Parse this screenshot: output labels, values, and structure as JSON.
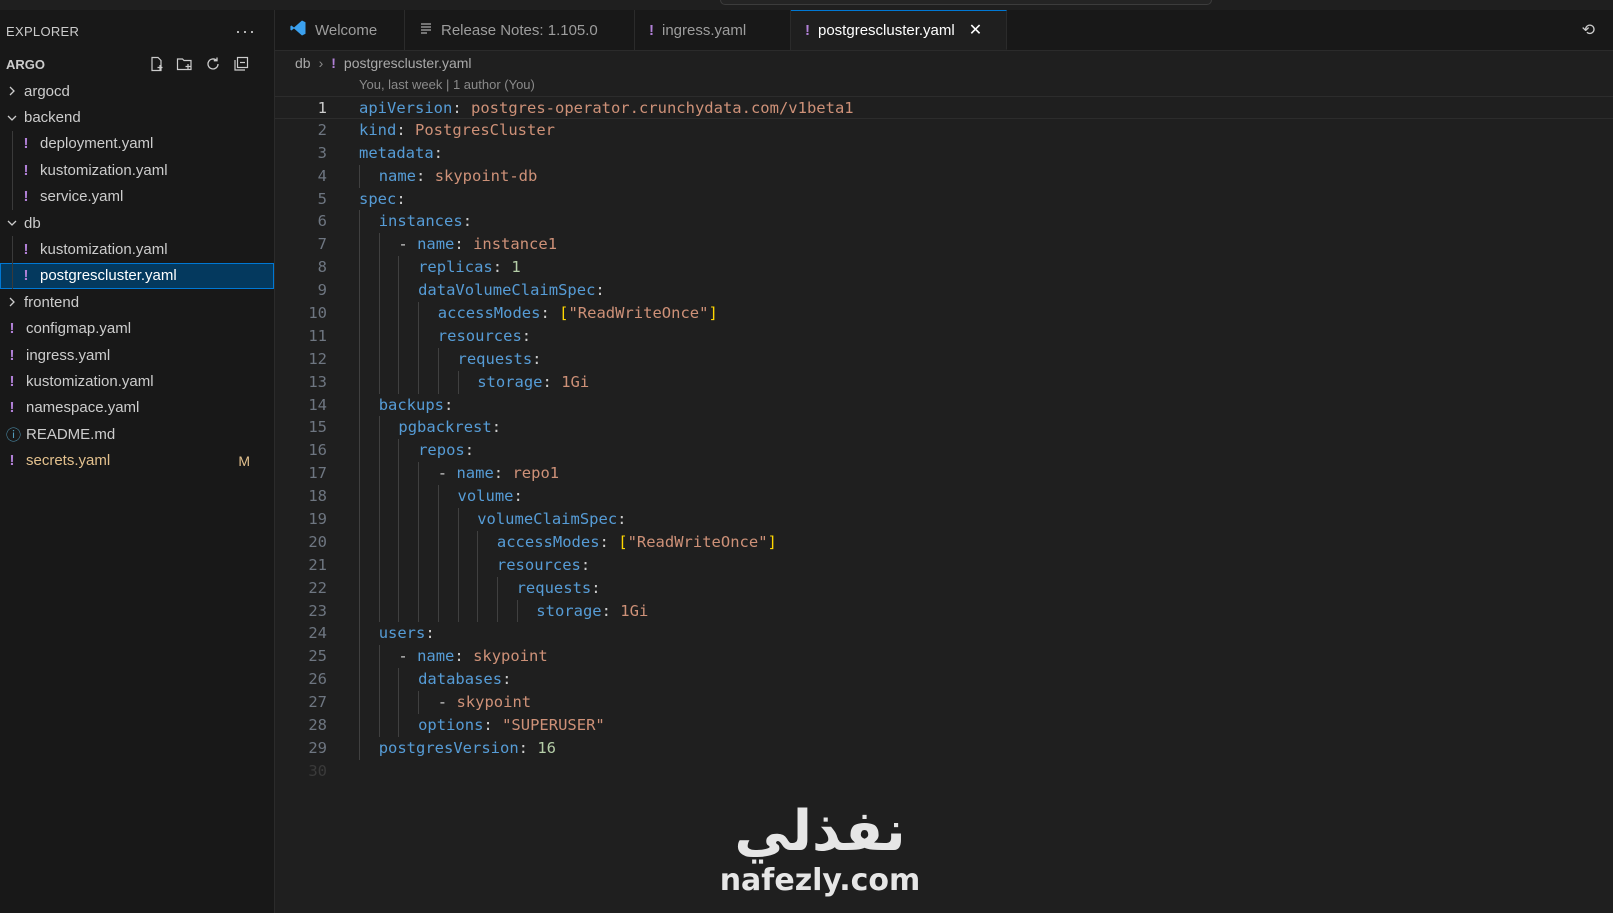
{
  "sidebar": {
    "title": "EXPLORER",
    "more": "···",
    "project": "ARGO",
    "tree": [
      {
        "label": "argocd",
        "type": "folder",
        "open": false,
        "depth": 0
      },
      {
        "label": "backend",
        "type": "folder",
        "open": true,
        "depth": 0
      },
      {
        "label": "deployment.yaml",
        "type": "yaml",
        "depth": 1
      },
      {
        "label": "kustomization.yaml",
        "type": "yaml",
        "depth": 1
      },
      {
        "label": "service.yaml",
        "type": "yaml",
        "depth": 1
      },
      {
        "label": "db",
        "type": "folder",
        "open": true,
        "depth": 0
      },
      {
        "label": "kustomization.yaml",
        "type": "yaml",
        "depth": 1
      },
      {
        "label": "postgrescluster.yaml",
        "type": "yaml",
        "depth": 1,
        "selected": true
      },
      {
        "label": "frontend",
        "type": "folder",
        "open": false,
        "depth": 0
      },
      {
        "label": "configmap.yaml",
        "type": "yaml",
        "depth": 0
      },
      {
        "label": "ingress.yaml",
        "type": "yaml",
        "depth": 0
      },
      {
        "label": "kustomization.yaml",
        "type": "yaml",
        "depth": 0
      },
      {
        "label": "namespace.yaml",
        "type": "yaml",
        "depth": 0
      },
      {
        "label": "README.md",
        "type": "md",
        "depth": 0
      },
      {
        "label": "secrets.yaml",
        "type": "yaml",
        "depth": 0,
        "badge": "M"
      }
    ]
  },
  "tabs": [
    {
      "label": "Welcome",
      "icon": "vscode-icon"
    },
    {
      "label": "Release Notes: 1.105.0",
      "icon": "notes-icon"
    },
    {
      "label": "ingress.yaml",
      "icon": "yaml-icon"
    },
    {
      "label": "postgrescluster.yaml",
      "icon": "yaml-icon",
      "active": true
    }
  ],
  "breadcrumb": {
    "folder": "db",
    "file": "postgrescluster.yaml"
  },
  "blame": "You, last week | 1 author (You)",
  "code": [
    [
      0,
      [
        [
          "k",
          "apiVersion"
        ],
        [
          "p",
          ": "
        ],
        [
          "s",
          "postgres-operator.crunchydata.com/v1beta1"
        ]
      ]
    ],
    [
      0,
      [
        [
          "k",
          "kind"
        ],
        [
          "p",
          ": "
        ],
        [
          "s",
          "PostgresCluster"
        ]
      ]
    ],
    [
      0,
      [
        [
          "k",
          "metadata"
        ],
        [
          "p",
          ":"
        ]
      ]
    ],
    [
      1,
      [
        [
          "k",
          "name"
        ],
        [
          "p",
          ": "
        ],
        [
          "s",
          "skypoint-db"
        ]
      ]
    ],
    [
      0,
      [
        [
          "k",
          "spec"
        ],
        [
          "p",
          ":"
        ]
      ]
    ],
    [
      1,
      [
        [
          "k",
          "instances"
        ],
        [
          "p",
          ":"
        ]
      ]
    ],
    [
      2,
      [
        [
          "p",
          "- "
        ],
        [
          "k",
          "name"
        ],
        [
          "p",
          ": "
        ],
        [
          "s",
          "instance1"
        ]
      ]
    ],
    [
      3,
      [
        [
          "k",
          "replicas"
        ],
        [
          "p",
          ": "
        ],
        [
          "n",
          "1"
        ]
      ]
    ],
    [
      3,
      [
        [
          "k",
          "dataVolumeClaimSpec"
        ],
        [
          "p",
          ":"
        ]
      ]
    ],
    [
      4,
      [
        [
          "k",
          "accessModes"
        ],
        [
          "p",
          ": "
        ],
        [
          "br",
          "["
        ],
        [
          "s",
          "\"ReadWriteOnce\""
        ],
        [
          "br",
          "]"
        ]
      ]
    ],
    [
      4,
      [
        [
          "k",
          "resources"
        ],
        [
          "p",
          ":"
        ]
      ]
    ],
    [
      5,
      [
        [
          "k",
          "requests"
        ],
        [
          "p",
          ":"
        ]
      ]
    ],
    [
      6,
      [
        [
          "k",
          "storage"
        ],
        [
          "p",
          ": "
        ],
        [
          "s",
          "1Gi"
        ]
      ]
    ],
    [
      1,
      [
        [
          "k",
          "backups"
        ],
        [
          "p",
          ":"
        ]
      ]
    ],
    [
      2,
      [
        [
          "k",
          "pgbackrest"
        ],
        [
          "p",
          ":"
        ]
      ]
    ],
    [
      3,
      [
        [
          "k",
          "repos"
        ],
        [
          "p",
          ":"
        ]
      ]
    ],
    [
      4,
      [
        [
          "p",
          "- "
        ],
        [
          "k",
          "name"
        ],
        [
          "p",
          ": "
        ],
        [
          "s",
          "repo1"
        ]
      ]
    ],
    [
      5,
      [
        [
          "k",
          "volume"
        ],
        [
          "p",
          ":"
        ]
      ]
    ],
    [
      6,
      [
        [
          "k",
          "volumeClaimSpec"
        ],
        [
          "p",
          ":"
        ]
      ]
    ],
    [
      7,
      [
        [
          "k",
          "accessModes"
        ],
        [
          "p",
          ": "
        ],
        [
          "br",
          "["
        ],
        [
          "s",
          "\"ReadWriteOnce\""
        ],
        [
          "br",
          "]"
        ]
      ]
    ],
    [
      7,
      [
        [
          "k",
          "resources"
        ],
        [
          "p",
          ":"
        ]
      ]
    ],
    [
      8,
      [
        [
          "k",
          "requests"
        ],
        [
          "p",
          ":"
        ]
      ]
    ],
    [
      9,
      [
        [
          "k",
          "storage"
        ],
        [
          "p",
          ": "
        ],
        [
          "s",
          "1Gi"
        ]
      ]
    ],
    [
      1,
      [
        [
          "k",
          "users"
        ],
        [
          "p",
          ":"
        ]
      ]
    ],
    [
      2,
      [
        [
          "p",
          "- "
        ],
        [
          "k",
          "name"
        ],
        [
          "p",
          ": "
        ],
        [
          "s",
          "skypoint"
        ]
      ]
    ],
    [
      3,
      [
        [
          "k",
          "databases"
        ],
        [
          "p",
          ":"
        ]
      ]
    ],
    [
      4,
      [
        [
          "p",
          "- "
        ],
        [
          "s",
          "skypoint"
        ]
      ]
    ],
    [
      3,
      [
        [
          "k",
          "options"
        ],
        [
          "p",
          ": "
        ],
        [
          "s",
          "\"SUPERUSER\""
        ]
      ]
    ],
    [
      1,
      [
        [
          "k",
          "postgresVersion"
        ],
        [
          "p",
          ": "
        ],
        [
          "n",
          "16"
        ]
      ]
    ],
    [
      0,
      []
    ]
  ],
  "watermark": {
    "arabic": "نفذلي",
    "latin": "nafezly.com"
  },
  "colors": {
    "accent": "#0078d4",
    "yaml_icon": "#b180d7",
    "key": "#569cd6",
    "string": "#ce9178",
    "number": "#b5cea8",
    "modified": "#e2c08d"
  }
}
